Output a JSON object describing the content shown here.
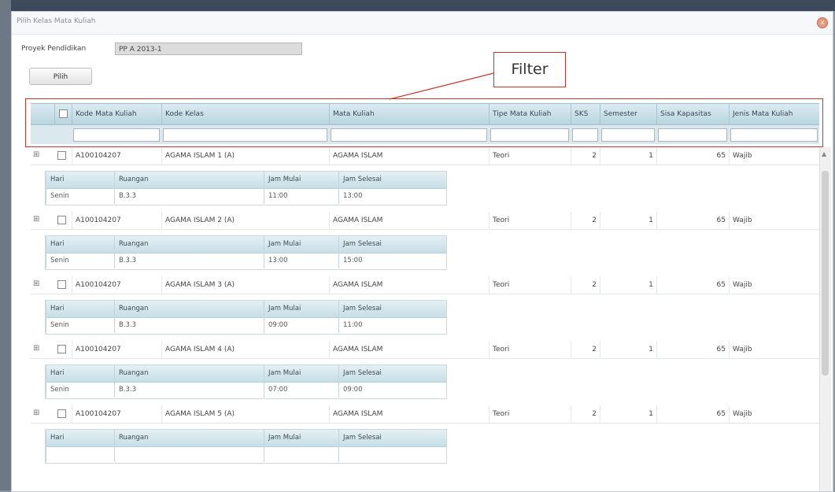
{
  "dialog": {
    "title": "Pilih Kelas Mata Kuliah",
    "close_glyph": "x"
  },
  "form": {
    "proyek_label": "Proyek Pendidikan",
    "proyek_value": "PP A 2013-1",
    "pilih_label": "Pilih"
  },
  "callout": {
    "label": "Filter"
  },
  "grid": {
    "headers": {
      "kode_mk": "Kode Mata Kuliah",
      "kode_kelas": "Kode Kelas",
      "mata_kuliah": "Mata Kuliah",
      "tipe": "Tipe Mata Kuliah",
      "sks": "SKS",
      "semester": "Semester",
      "sisa": "Sisa Kapasitas",
      "jenis": "Jenis Mata Kuliah"
    },
    "sub_headers": {
      "hari": "Hari",
      "ruangan": "Ruangan",
      "jam_mulai": "Jam Mulai",
      "jam_selesai": "Jam Selesai"
    },
    "rows": [
      {
        "kode_mk": "A100104207",
        "kode_kelas": "AGAMA ISLAM 1 (A)",
        "mata_kuliah": "AGAMA ISLAM",
        "tipe": "Teori",
        "sks": "2",
        "semester": "1",
        "sisa": "65",
        "jenis": "Wajib",
        "schedule": {
          "hari": "Senin",
          "ruangan": "B.3.3",
          "jam_mulai": "11:00",
          "jam_selesai": "13:00"
        }
      },
      {
        "kode_mk": "A100104207",
        "kode_kelas": "AGAMA ISLAM 2 (A)",
        "mata_kuliah": "AGAMA ISLAM",
        "tipe": "Teori",
        "sks": "2",
        "semester": "1",
        "sisa": "65",
        "jenis": "Wajib",
        "schedule": {
          "hari": "Senin",
          "ruangan": "B.3.3",
          "jam_mulai": "13:00",
          "jam_selesai": "15:00"
        }
      },
      {
        "kode_mk": "A100104207",
        "kode_kelas": "AGAMA ISLAM 3 (A)",
        "mata_kuliah": "AGAMA ISLAM",
        "tipe": "Teori",
        "sks": "2",
        "semester": "1",
        "sisa": "65",
        "jenis": "Wajib",
        "schedule": {
          "hari": "Senin",
          "ruangan": "B.3.3",
          "jam_mulai": "09:00",
          "jam_selesai": "11:00"
        }
      },
      {
        "kode_mk": "A100104207",
        "kode_kelas": "AGAMA ISLAM 4 (A)",
        "mata_kuliah": "AGAMA ISLAM",
        "tipe": "Teori",
        "sks": "2",
        "semester": "1",
        "sisa": "65",
        "jenis": "Wajib",
        "schedule": {
          "hari": "Senin",
          "ruangan": "B.3.3",
          "jam_mulai": "07:00",
          "jam_selesai": "09:00"
        }
      },
      {
        "kode_mk": "A100104207",
        "kode_kelas": "AGAMA ISLAM 5 (A)",
        "mata_kuliah": "AGAMA ISLAM",
        "tipe": "Teori",
        "sks": "2",
        "semester": "1",
        "sisa": "65",
        "jenis": "Wajib",
        "schedule": {
          "hari": "",
          "ruangan": "",
          "jam_mulai": "",
          "jam_selesai": ""
        }
      }
    ]
  }
}
